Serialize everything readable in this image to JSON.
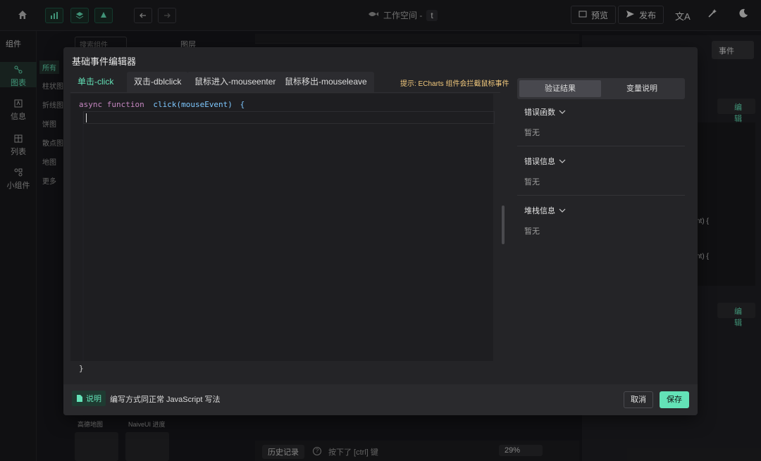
{
  "topbar": {
    "workspace_label": "工作空间 -",
    "workspace_tag": "t",
    "preview_label": "预览",
    "publish_label": "发布"
  },
  "sidebar": {
    "title": "组件",
    "items": [
      {
        "label": "图表",
        "icon": "chart-icon"
      },
      {
        "label": "信息",
        "icon": "info-icon"
      },
      {
        "label": "列表",
        "icon": "table-icon"
      },
      {
        "label": "小组件",
        "icon": "widget-icon"
      }
    ],
    "categories": [
      "所有",
      "柱状图",
      "折线图",
      "饼图",
      "散点图",
      "地图",
      "更多"
    ],
    "search_placeholder": "搜索组件",
    "layers_label": "图层"
  },
  "right_panel": {
    "tabs": [
      "定制",
      "动画",
      "数据",
      "事件"
    ],
    "edit_label": "编辑",
    "code_snippet_1": "nt) {",
    "code_snippet_2": "nt) {"
  },
  "bottom_bg": {
    "cards": [
      "高德地图",
      "NaiveUI 进度"
    ],
    "history_label": "历史记录",
    "shortcut_hint": "按下了 [ctrl] 键",
    "zoom": "29%"
  },
  "modal": {
    "title": "基础事件编辑器",
    "tabs": [
      "单击-click",
      "双击-dblclick",
      "鼠标进入-mouseenter",
      "鼠标移出-mouseleave"
    ],
    "hint": "提示: ECharts 组件会拦截鼠标事件",
    "code": {
      "keyword": "async function",
      "signature": "click(mouseEvent)",
      "open_brace": "{",
      "close_brace": "}"
    },
    "result_tabs": [
      "验证结果",
      "变量说明"
    ],
    "sections": [
      {
        "title": "错误函数",
        "value": "暂无"
      },
      {
        "title": "错误信息",
        "value": "暂无"
      },
      {
        "title": "堆栈信息",
        "value": "暂无"
      }
    ],
    "footer": {
      "badge": "说明",
      "note": "编写方式同正常 JavaScript 写法",
      "cancel": "取消",
      "save": "保存"
    }
  },
  "colors": {
    "accent": "#63e2b7",
    "hint": "#f2c97d",
    "keyword": "#c586c0",
    "function": "#7ec8ff"
  }
}
